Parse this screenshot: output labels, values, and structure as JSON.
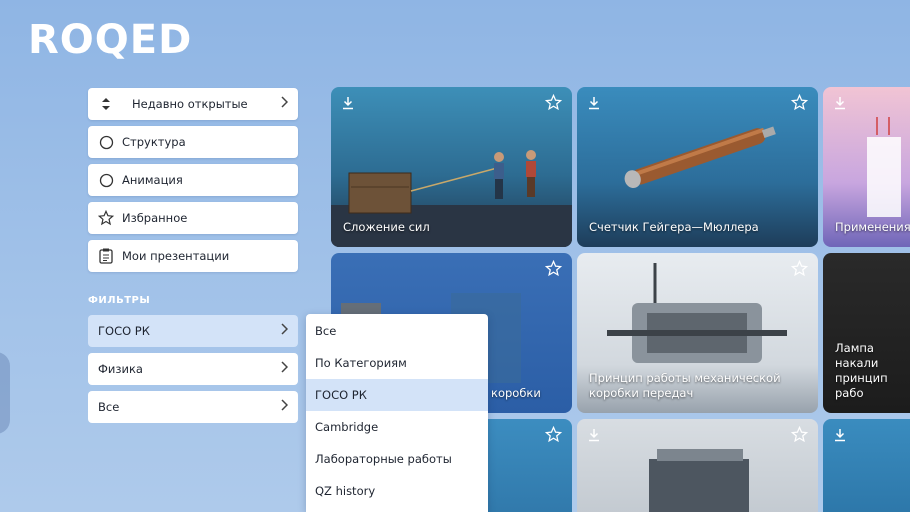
{
  "app": {
    "logo": "ROQED"
  },
  "menu": {
    "items": [
      {
        "label": "Недавно открытые",
        "icon": "sort-icon"
      },
      {
        "label": "Структура",
        "icon": "radio-icon"
      },
      {
        "label": "Анимация",
        "icon": "radio-icon"
      },
      {
        "label": "Избранное",
        "icon": "star-icon"
      },
      {
        "label": "Мои презентации",
        "icon": "clipboard-icon"
      }
    ]
  },
  "filters": {
    "title": "ФИЛЬТРЫ",
    "items": [
      {
        "label": "ГОСО РК",
        "active": true
      },
      {
        "label": "Физика",
        "active": false
      },
      {
        "label": "Все",
        "active": false
      }
    ]
  },
  "dropdown": {
    "options": [
      "Все",
      "По Категориям",
      "ГОСО РК",
      "Cambridge",
      "Лабораторные работы",
      "QZ history"
    ],
    "selected": "ГОСО РК"
  },
  "cards": [
    {
      "title": "Сложение сил"
    },
    {
      "title": "Счетчик Гейгера—Мюллера"
    },
    {
      "title": "Применения"
    },
    {
      "title": "коробки"
    },
    {
      "title": "Принцип работы механической коробки передач"
    },
    {
      "title": "Лампа накали принцип рабо"
    },
    {
      "title": ""
    },
    {
      "title": ""
    },
    {
      "title": ""
    }
  ],
  "colors": {
    "accent": "#d3e3f8",
    "background": "#9dbde6"
  }
}
